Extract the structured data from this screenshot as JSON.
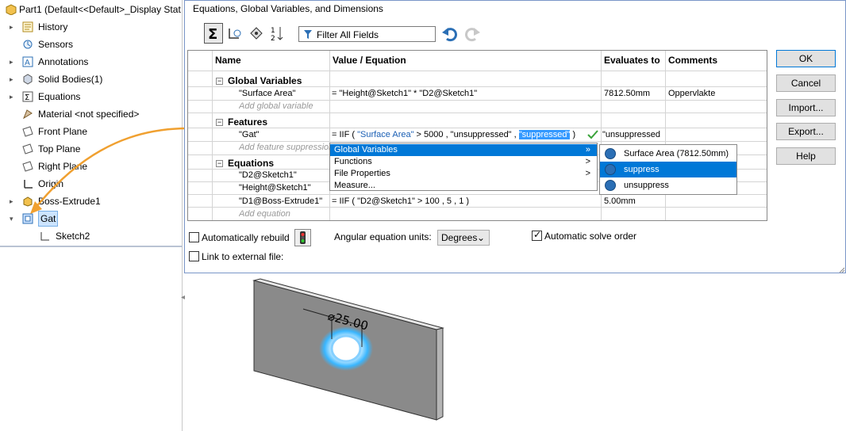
{
  "tree": {
    "root_label": "Part1  (Default<<Default>_Display Stat",
    "items": [
      {
        "label": "History",
        "icon": "history-icon",
        "expandable": true
      },
      {
        "label": "Sensors",
        "icon": "sensor-icon",
        "expandable": false
      },
      {
        "label": "Annotations",
        "icon": "annotations-icon",
        "expandable": true
      },
      {
        "label": "Solid Bodies(1)",
        "icon": "solid-bodies-icon",
        "expandable": true
      },
      {
        "label": "Equations",
        "icon": "equations-icon",
        "expandable": true
      },
      {
        "label": "Material <not specified>",
        "icon": "material-icon",
        "expandable": false
      },
      {
        "label": "Front Plane",
        "icon": "plane-icon",
        "expandable": false
      },
      {
        "label": "Top Plane",
        "icon": "plane-icon",
        "expandable": false
      },
      {
        "label": "Right Plane",
        "icon": "plane-icon",
        "expandable": false
      },
      {
        "label": "Origin",
        "icon": "origin-icon",
        "expandable": false
      },
      {
        "label": "Boss-Extrude1",
        "icon": "extrude-icon",
        "expandable": true
      },
      {
        "label": "Gat",
        "icon": "cut-icon",
        "expandable": true,
        "selected": true
      },
      {
        "label": "Sketch2",
        "icon": "sketch-icon",
        "expandable": false
      }
    ]
  },
  "dialog": {
    "title": "Equations, Global Variables, and Dimensions",
    "filter_label": "Filter All Fields",
    "columns": [
      "Name",
      "Value / Equation",
      "Evaluates to",
      "Comments"
    ],
    "sections": {
      "global": "Global Variables",
      "features": "Features",
      "equations": "Equations"
    },
    "rows": {
      "surface_area": {
        "name": "\"Surface Area\"",
        "value": "= \"Height@Sketch1\" * \"D2@Sketch1\"",
        "evaluates": "7812.50mm",
        "comments": "Oppervlakte"
      },
      "add_global": "Add global variable",
      "gat": {
        "name": "\"Gat\"",
        "value_prefix": "= IIF ( ",
        "value_kw": "\"Surface Area\"",
        "value_mid": " > 5000 , \"unsuppressed\" , ",
        "value_sel": "\"suppressed\"",
        "value_suffix": " )",
        "evaluates": "\"unsuppressed"
      },
      "add_feature": "Add feature suppression",
      "d2": {
        "name": "\"D2@Sketch1\""
      },
      "height": {
        "name": "\"Height@Sketch1\""
      },
      "d1": {
        "name": "\"D1@Boss-Extrude1\"",
        "value": "= IIF ( \"D2@Sketch1\" > 100 , 5 , 1 )",
        "evaluates": "5.00mm"
      },
      "add_equation": "Add equation"
    },
    "menu": [
      "Global Variables",
      "Functions",
      "File Properties",
      "Measure..."
    ],
    "submenu": [
      "Surface Area (7812.50mm)",
      "suppress",
      "unsuppress"
    ],
    "buttons": {
      "ok": "OK",
      "cancel": "Cancel",
      "import": "Import...",
      "export": "Export...",
      "help": "Help"
    },
    "auto_rebuild": "Automatically rebuild",
    "angular_units_label": "Angular equation units:",
    "angular_units_value": "Degrees",
    "auto_solve": "Automatic solve order",
    "link_external": "Link to external file:"
  },
  "model": {
    "dimension": "25.00"
  },
  "colors": {
    "accent": "#0078d7",
    "keyword": "#1a5fb4",
    "arrow": "#f0a030"
  }
}
